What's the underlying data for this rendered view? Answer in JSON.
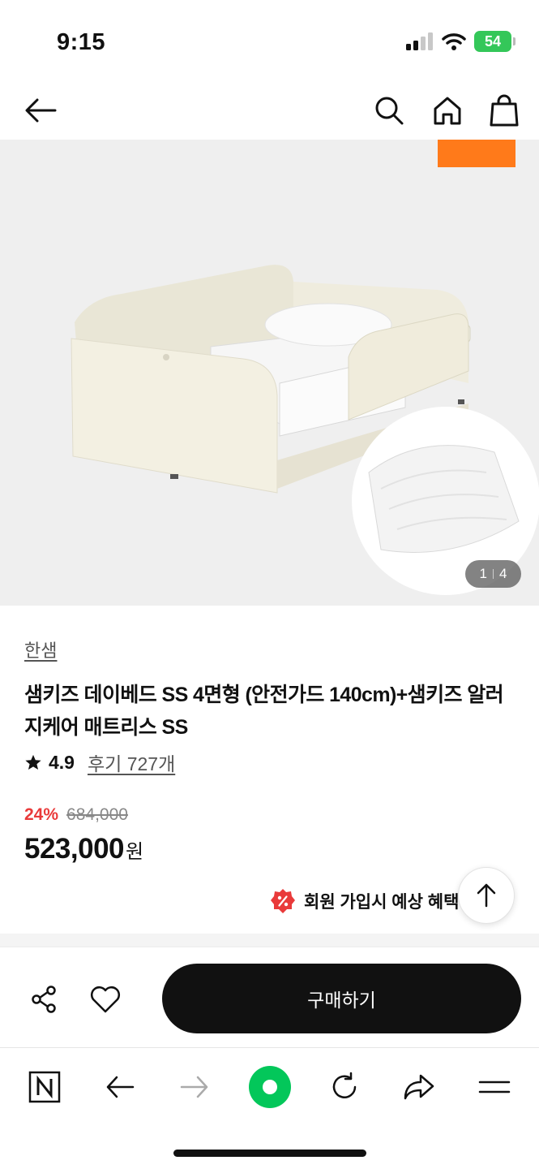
{
  "status": {
    "time": "9:15",
    "battery": "54"
  },
  "header": {
    "back_icon": "arrow-left-icon",
    "search_icon": "search-icon",
    "home_icon": "home-icon",
    "cart_icon": "shopping-bag-icon"
  },
  "gallery": {
    "current": "1",
    "total": "4",
    "tag_color": "#ff7a1a"
  },
  "product": {
    "brand": "한샘",
    "title": "샘키즈 데이베드 SS 4면형 (안전가드 140cm)+샘키즈 알러지케어 매트리스 SS",
    "rating": "4.9",
    "reviews": "후기 727개",
    "discount": "24%",
    "original_price": "684,000",
    "price": "523,000",
    "currency": "원",
    "benefit": "회원 가입시 예상 혜택",
    "discount_color": "#e93a3a"
  },
  "actions": {
    "buy_label": "구매하기",
    "share_icon": "share-icon",
    "wish_icon": "heart-icon"
  },
  "browser": {
    "accent": "#03c75a"
  }
}
